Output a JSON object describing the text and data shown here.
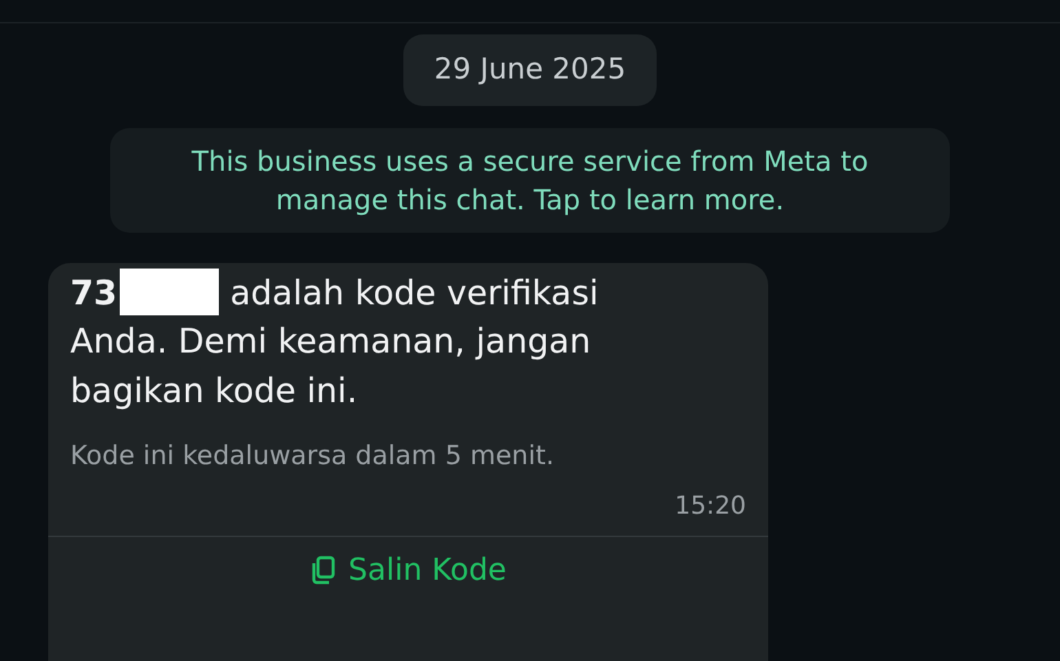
{
  "date_chip": "29 June 2025",
  "notice": "This business uses a secure service from Meta to manage this chat. Tap to learn more.",
  "message": {
    "code_start": "73",
    "text_first_line": "adalah kode verifikasi",
    "text_rest": "Anda. Demi keamanan, jangan bagikan kode ini.",
    "footer": "Kode ini kedaluwarsa dalam 5 menit.",
    "time": "15:20",
    "action": "Salin Kode"
  }
}
